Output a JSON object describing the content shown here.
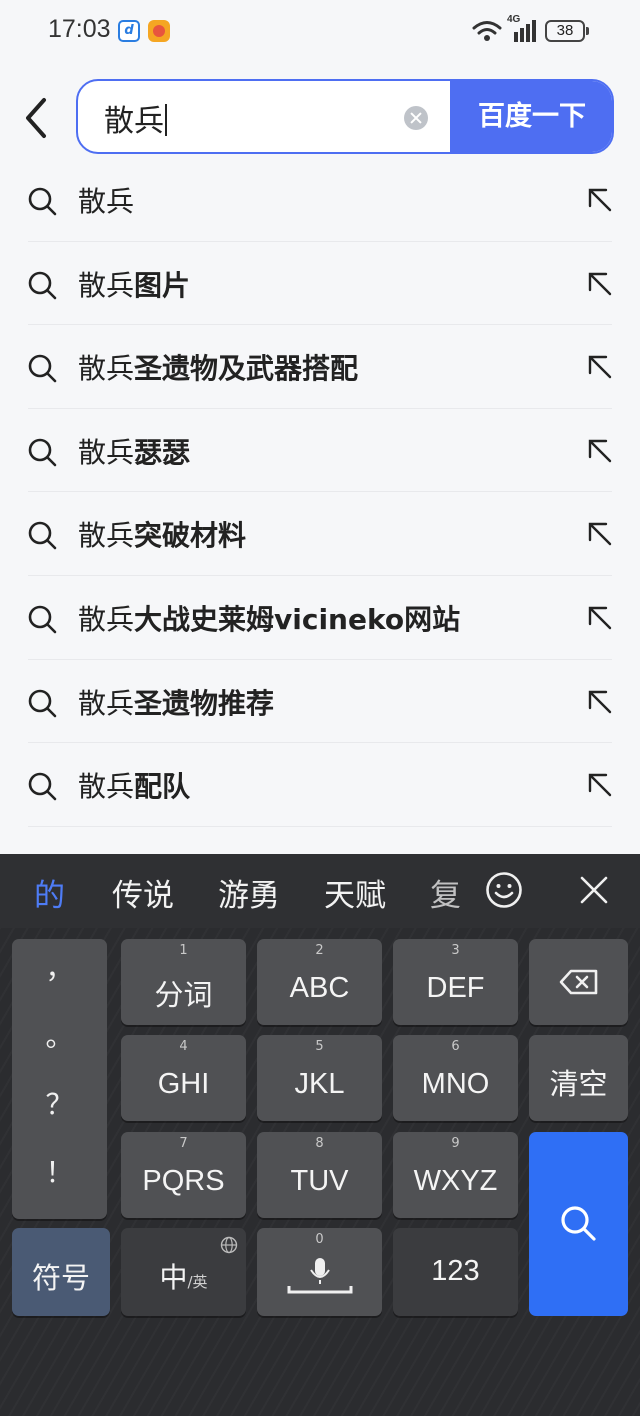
{
  "status_bar": {
    "time": "17:03",
    "network": "4G",
    "battery": "38"
  },
  "search": {
    "query": "散兵",
    "button_label": "百度一下"
  },
  "suggestions": [
    {
      "prefix": "散兵",
      "suffix": ""
    },
    {
      "prefix": "散兵",
      "suffix": "图片"
    },
    {
      "prefix": "散兵",
      "suffix": "圣遗物及武器搭配"
    },
    {
      "prefix": "散兵",
      "suffix": "瑟瑟"
    },
    {
      "prefix": "散兵",
      "suffix": "突破材料"
    },
    {
      "prefix": "散兵",
      "suffix": "大战史莱姆vicineko网站"
    },
    {
      "prefix": "散兵",
      "suffix": "圣遗物推荐"
    },
    {
      "prefix": "散兵",
      "suffix": "配队"
    }
  ],
  "keyboard": {
    "candidates": [
      "的",
      "传说",
      "游勇",
      "天赋",
      "复"
    ],
    "punctuation": [
      "，",
      "。",
      "？",
      "！"
    ],
    "keys": [
      {
        "num": "1",
        "label": "分词"
      },
      {
        "num": "2",
        "label": "ABC"
      },
      {
        "num": "3",
        "label": "DEF"
      },
      {
        "num": "4",
        "label": "GHI"
      },
      {
        "num": "5",
        "label": "JKL"
      },
      {
        "num": "6",
        "label": "MNO"
      },
      {
        "num": "7",
        "label": "PQRS"
      },
      {
        "num": "8",
        "label": "TUV"
      },
      {
        "num": "9",
        "label": "WXYZ"
      }
    ],
    "clear_label": "清空",
    "symbol_label": "符号",
    "lang_main": "中",
    "lang_alt": "/英",
    "space_num": "0",
    "num_label": "123"
  },
  "colors": {
    "accent": "#4e6ef2",
    "keyboard_bg": "#2b2c2f",
    "key_bg": "#505154",
    "search_key": "#2f6ff5",
    "candidate_active": "#4e7cf6"
  }
}
